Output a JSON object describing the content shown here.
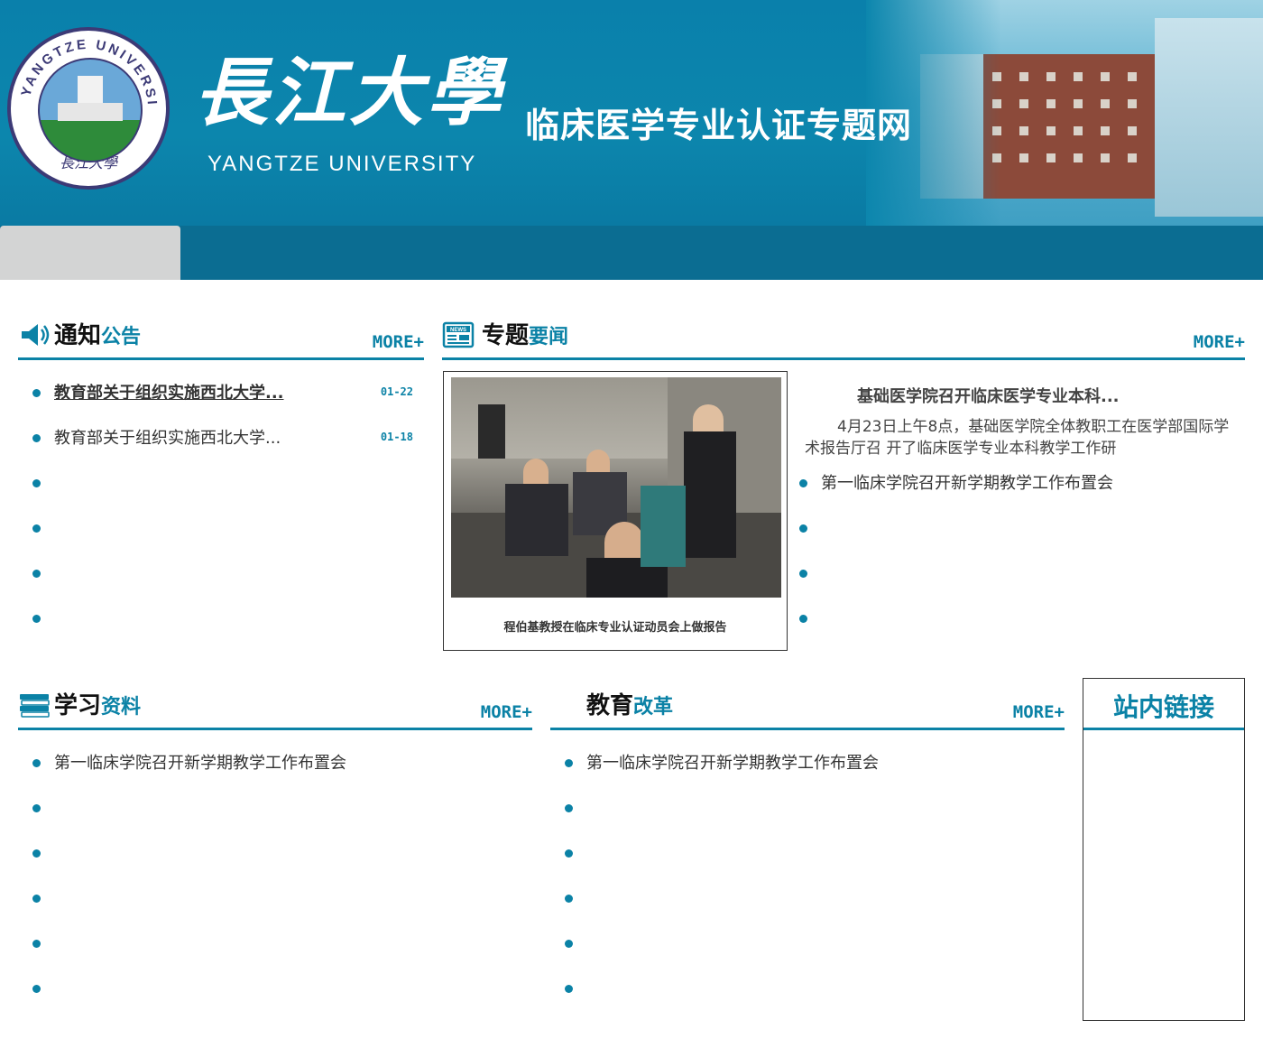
{
  "header": {
    "logo_ring_text": "YANGTZE UNIVERSITY",
    "logo_bottom_text": "長江大學",
    "cn_name": "長江大學",
    "en_name": "YANGTZE UNIVERSITY",
    "site_title": "临床医学专业认证专题网"
  },
  "notices": {
    "title_main": "通知",
    "title_accent": "公告",
    "more": "MORE+",
    "items": [
      {
        "text": "教育部关于组织实施西北大学...",
        "date": "01-22"
      },
      {
        "text": "教育部关于组织实施西北大学...",
        "date": "01-18"
      },
      {
        "text": "",
        "date": ""
      },
      {
        "text": "",
        "date": ""
      },
      {
        "text": "",
        "date": ""
      },
      {
        "text": "",
        "date": ""
      }
    ]
  },
  "news": {
    "title_main": "专题",
    "title_accent": "要闻",
    "more": "MORE+",
    "photo_caption": "程伯基教授在临床专业认证动员会上做报告",
    "feature_title": "基础医学院召开临床医学专业本科...",
    "feature_body": "4月23日上午8点，基础医学院全体教职工在医学部国际学术报告厅召 开了临床医学专业本科教学工作研",
    "items": [
      {
        "text": "第一临床学院召开新学期教学工作布置会"
      },
      {
        "text": ""
      },
      {
        "text": ""
      },
      {
        "text": ""
      }
    ]
  },
  "study": {
    "title_main": "学习",
    "title_accent": "资料",
    "more": "MORE+",
    "items": [
      {
        "text": "第一临床学院召开新学期教学工作布置会"
      },
      {
        "text": ""
      },
      {
        "text": ""
      },
      {
        "text": ""
      },
      {
        "text": ""
      },
      {
        "text": ""
      }
    ]
  },
  "reform": {
    "title_main": "教育",
    "title_accent": "改革",
    "more": "MORE+",
    "items": [
      {
        "text": "第一临床学院召开新学期教学工作布置会"
      },
      {
        "text": ""
      },
      {
        "text": ""
      },
      {
        "text": ""
      },
      {
        "text": ""
      },
      {
        "text": ""
      }
    ]
  },
  "links": {
    "title": "站内链接"
  },
  "colors": {
    "header_blue": "#0c86ad",
    "nav_blue": "#0b6d92",
    "accent": "#0b82a6"
  }
}
